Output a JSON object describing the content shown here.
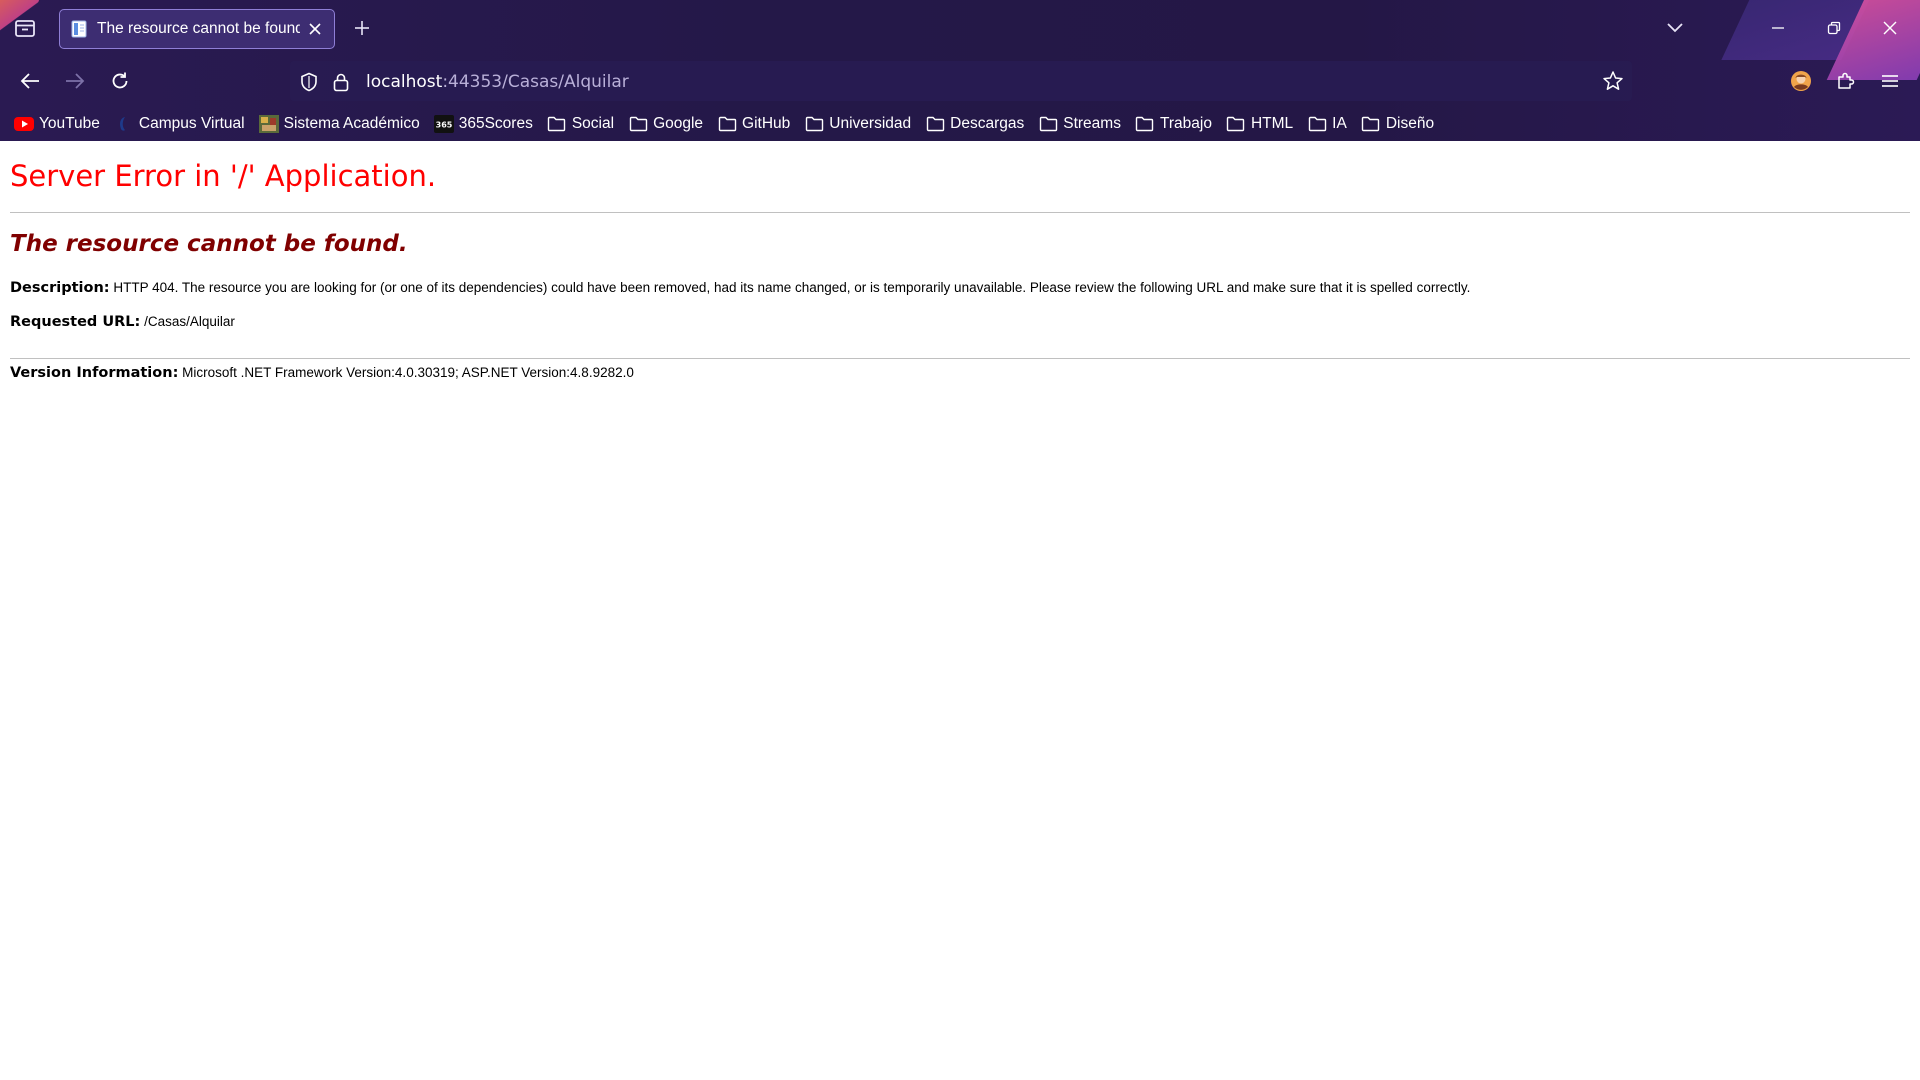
{
  "browser": {
    "tab": {
      "title": "The resource cannot be found."
    },
    "url": {
      "host": "localhost",
      "rest": ":44353/Casas/Alquilar"
    },
    "bookmarks": [
      {
        "label": "YouTube",
        "icon": "youtube-icon"
      },
      {
        "label": "Campus Virtual",
        "icon": "campus-virtual-icon"
      },
      {
        "label": "Sistema Académico",
        "icon": "sistema-academico-icon"
      },
      {
        "label": "365Scores",
        "icon": "365scores-icon"
      },
      {
        "label": "Social",
        "icon": "folder-icon"
      },
      {
        "label": "Google",
        "icon": "folder-icon"
      },
      {
        "label": "GitHub",
        "icon": "folder-icon"
      },
      {
        "label": "Universidad",
        "icon": "folder-icon"
      },
      {
        "label": "Descargas",
        "icon": "folder-icon"
      },
      {
        "label": "Streams",
        "icon": "folder-icon"
      },
      {
        "label": "Trabajo",
        "icon": "folder-icon"
      },
      {
        "label": "HTML",
        "icon": "folder-icon"
      },
      {
        "label": "IA",
        "icon": "folder-icon"
      },
      {
        "label": "Diseño",
        "icon": "folder-icon"
      }
    ],
    "colors": {
      "chrome_bg": "#241848",
      "tab_border": "#8f7fd6",
      "url_dim": "#b9b0d8"
    }
  },
  "page": {
    "title": "Server Error in '/' Application.",
    "subtitle": "The resource cannot be found.",
    "description_label": "Description:",
    "description_text": " HTTP 404. The resource you are looking for (or one of its dependencies) could have been removed, had its name changed, or is temporarily unavailable.  Please review the following URL and make sure that it is spelled correctly.",
    "requested_label": "Requested URL:",
    "requested_text": " /Casas/Alquilar",
    "version_label": "Version Information:",
    "version_text": " Microsoft .NET Framework Version:4.0.30319; ASP.NET Version:4.8.9282.0",
    "colors": {
      "title": "#ff0000",
      "subtitle": "#800000"
    }
  }
}
